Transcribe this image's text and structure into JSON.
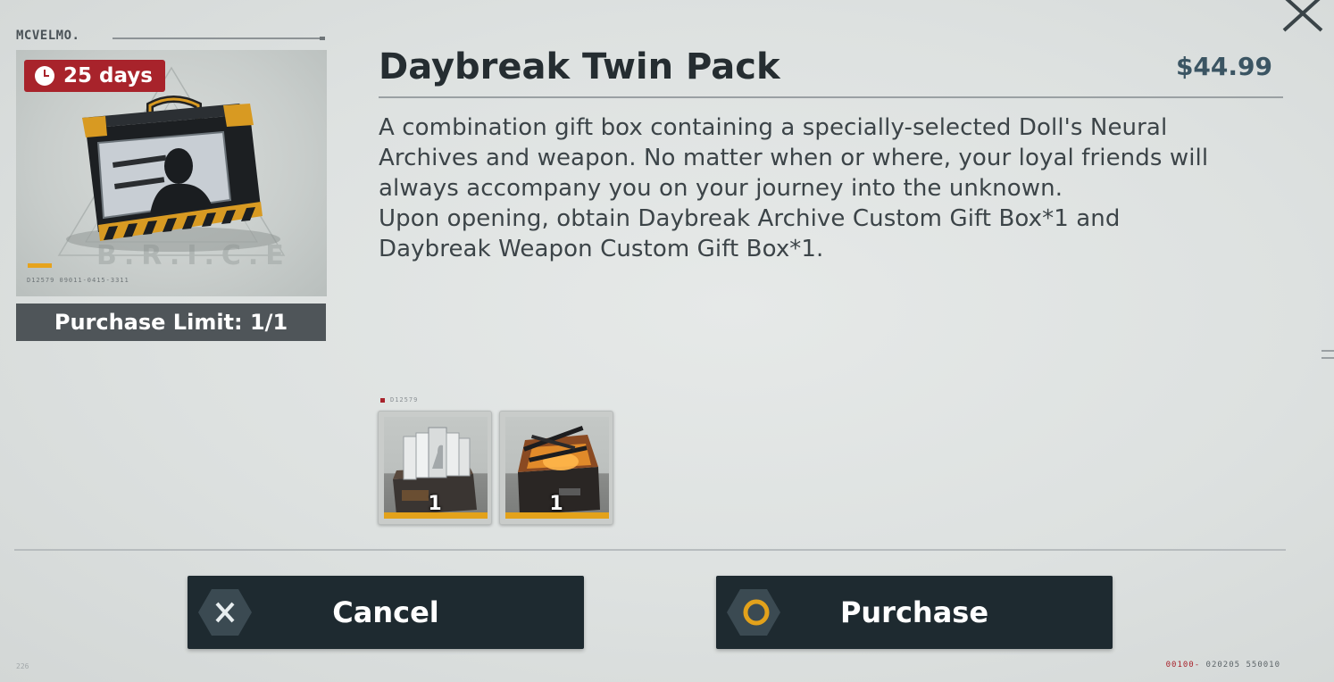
{
  "brand": {
    "logo_text": "MCVELMO."
  },
  "product": {
    "badge_days": "25 days",
    "image_serial": "D12579  09011-0415-3311",
    "purchase_limit": "Purchase Limit: 1/1",
    "title": "Daybreak Twin Pack",
    "price": "$44.99",
    "description_lines": [
      "A combination gift box containing a specially-selected Doll's Neural",
      "Archives and weapon. No matter when or where, your loyal friends will",
      "always accompany you on your journey into the unknown.",
      "Upon opening, obtain Daybreak Archive Custom Gift Box*1 and",
      "Daybreak Weapon Custom Gift Box*1."
    ]
  },
  "contents": {
    "code": "D12579",
    "items": [
      {
        "icon": "archive-gift-box-icon",
        "quantity": "1"
      },
      {
        "icon": "weapon-gift-box-icon",
        "quantity": "1"
      }
    ]
  },
  "actions": {
    "cancel_label": "Cancel",
    "purchase_label": "Purchase"
  },
  "footer": {
    "left_code": "226",
    "right_code_red": "00100-",
    "right_code": "020205  550010"
  },
  "colors": {
    "badge": "#a8232b",
    "accent": "#e3a21b",
    "button_bg": "#1e2a30",
    "price": "#3b5563"
  }
}
